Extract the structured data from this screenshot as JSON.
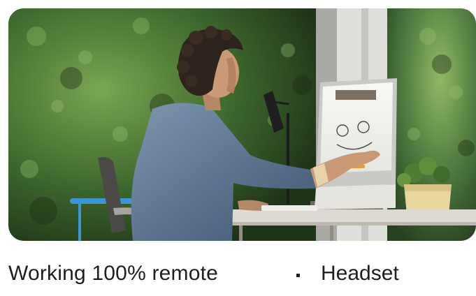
{
  "card": {
    "image_alt": "Person working on a touchscreen desk device with a video meeting and whiteboard",
    "caption": "Working 100% remote",
    "bullets": [
      "Headset"
    ]
  },
  "colors": {
    "text": "#1f1f1f",
    "foliage_dark": "#2c4a22",
    "foliage_light": "#6f9b4a",
    "shirt": "#56708f",
    "desk": "#d8d5cc"
  }
}
